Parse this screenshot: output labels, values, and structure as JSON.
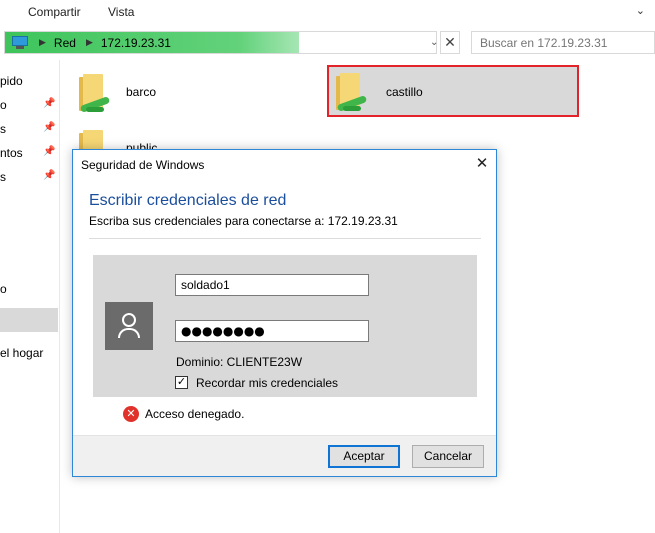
{
  "ribbon": {
    "tabs": [
      "Compartir",
      "Vista"
    ],
    "expand_icon": "chevron-down-icon"
  },
  "address": {
    "crumbs": [
      "Red",
      "172.19.23.31"
    ],
    "icon": "computer-icon",
    "progress_color": "#3ec45b"
  },
  "search": {
    "placeholder": "Buscar en 172.19.23.31"
  },
  "nav": {
    "items": [
      {
        "label": "pido",
        "pinned": false
      },
      {
        "label": "o",
        "pinned": true
      },
      {
        "label": "s",
        "pinned": true
      },
      {
        "label": "ntos",
        "pinned": true
      },
      {
        "label": "s",
        "pinned": true
      },
      {
        "label": "o",
        "pinned": false
      },
      {
        "label": "",
        "pinned": false
      },
      {
        "label": "el hogar",
        "pinned": false
      }
    ],
    "pin_glyph": "📌"
  },
  "folders": [
    {
      "name": "barco",
      "selected": false
    },
    {
      "name": "castillo",
      "selected": true
    },
    {
      "name": "public",
      "selected": false
    }
  ],
  "dialog": {
    "title": "Seguridad de Windows",
    "heading": "Escribir credenciales de red",
    "subtitle": "Escriba sus credenciales para conectarse a: 172.19.23.31",
    "username": "soldado1",
    "password_mask": "●●●●●●●●",
    "domain_label": "Dominio: CLIENTE23W",
    "remember_label": "Recordar mis credenciales",
    "remember_checked": true,
    "error": "Acceso denegado.",
    "ok_label": "Aceptar",
    "cancel_label": "Cancelar",
    "heading_color": "#1b4e9c",
    "error_color": "#e0322b"
  }
}
